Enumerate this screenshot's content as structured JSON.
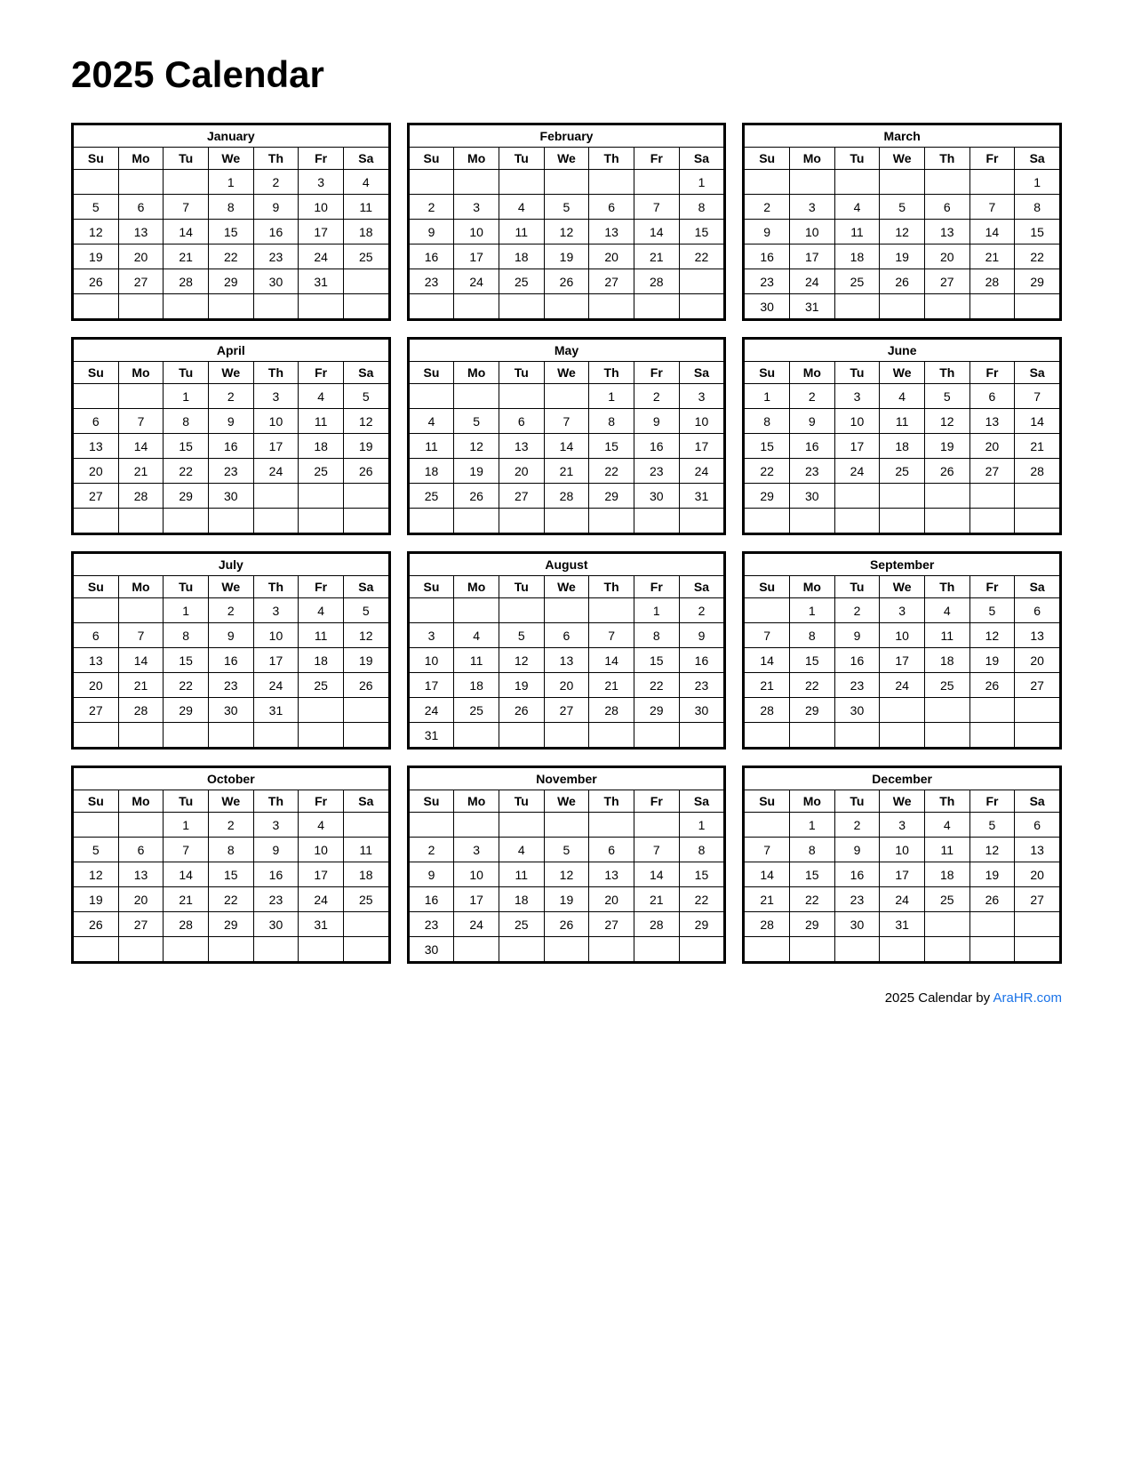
{
  "title": "2025 Calendar",
  "footer": {
    "text": "2025  Calendar by ",
    "link_text": "AraHR.com",
    "link_url": "https://AraHR.com"
  },
  "days_header": [
    "Su",
    "Mo",
    "Tu",
    "We",
    "Th",
    "Fr",
    "Sa"
  ],
  "months": [
    {
      "name": "January",
      "weeks": [
        [
          "",
          "",
          "",
          "1",
          "2",
          "3",
          "4"
        ],
        [
          "5",
          "6",
          "7",
          "8",
          "9",
          "10",
          "11"
        ],
        [
          "12",
          "13",
          "14",
          "15",
          "16",
          "17",
          "18"
        ],
        [
          "19",
          "20",
          "21",
          "22",
          "23",
          "24",
          "25"
        ],
        [
          "26",
          "27",
          "28",
          "29",
          "30",
          "31",
          ""
        ],
        [
          "",
          "",
          "",
          "",
          "",
          "",
          ""
        ]
      ]
    },
    {
      "name": "February",
      "weeks": [
        [
          "",
          "",
          "",
          "",
          "",
          "",
          "1"
        ],
        [
          "2",
          "3",
          "4",
          "5",
          "6",
          "7",
          "8"
        ],
        [
          "9",
          "10",
          "11",
          "12",
          "13",
          "14",
          "15"
        ],
        [
          "16",
          "17",
          "18",
          "19",
          "20",
          "21",
          "22"
        ],
        [
          "23",
          "24",
          "25",
          "26",
          "27",
          "28",
          ""
        ],
        [
          "",
          "",
          "",
          "",
          "",
          "",
          ""
        ]
      ]
    },
    {
      "name": "March",
      "weeks": [
        [
          "",
          "",
          "",
          "",
          "",
          "",
          "1"
        ],
        [
          "2",
          "3",
          "4",
          "5",
          "6",
          "7",
          "8"
        ],
        [
          "9",
          "10",
          "11",
          "12",
          "13",
          "14",
          "15"
        ],
        [
          "16",
          "17",
          "18",
          "19",
          "20",
          "21",
          "22"
        ],
        [
          "23",
          "24",
          "25",
          "26",
          "27",
          "28",
          "29"
        ],
        [
          "30",
          "31",
          "",
          "",
          "",
          "",
          ""
        ]
      ]
    },
    {
      "name": "April",
      "weeks": [
        [
          "",
          "",
          "1",
          "2",
          "3",
          "4",
          "5"
        ],
        [
          "6",
          "7",
          "8",
          "9",
          "10",
          "11",
          "12"
        ],
        [
          "13",
          "14",
          "15",
          "16",
          "17",
          "18",
          "19"
        ],
        [
          "20",
          "21",
          "22",
          "23",
          "24",
          "25",
          "26"
        ],
        [
          "27",
          "28",
          "29",
          "30",
          "",
          "",
          ""
        ],
        [
          "",
          "",
          "",
          "",
          "",
          "",
          ""
        ]
      ]
    },
    {
      "name": "May",
      "weeks": [
        [
          "",
          "",
          "",
          "",
          "1",
          "2",
          "3"
        ],
        [
          "4",
          "5",
          "6",
          "7",
          "8",
          "9",
          "10"
        ],
        [
          "11",
          "12",
          "13",
          "14",
          "15",
          "16",
          "17"
        ],
        [
          "18",
          "19",
          "20",
          "21",
          "22",
          "23",
          "24"
        ],
        [
          "25",
          "26",
          "27",
          "28",
          "29",
          "30",
          "31"
        ],
        [
          "",
          "",
          "",
          "",
          "",
          "",
          ""
        ]
      ]
    },
    {
      "name": "June",
      "weeks": [
        [
          "1",
          "2",
          "3",
          "4",
          "5",
          "6",
          "7"
        ],
        [
          "8",
          "9",
          "10",
          "11",
          "12",
          "13",
          "14"
        ],
        [
          "15",
          "16",
          "17",
          "18",
          "19",
          "20",
          "21"
        ],
        [
          "22",
          "23",
          "24",
          "25",
          "26",
          "27",
          "28"
        ],
        [
          "29",
          "30",
          "",
          "",
          "",
          "",
          ""
        ],
        [
          "",
          "",
          "",
          "",
          "",
          "",
          ""
        ]
      ]
    },
    {
      "name": "July",
      "weeks": [
        [
          "",
          "",
          "1",
          "2",
          "3",
          "4",
          "5"
        ],
        [
          "6",
          "7",
          "8",
          "9",
          "10",
          "11",
          "12"
        ],
        [
          "13",
          "14",
          "15",
          "16",
          "17",
          "18",
          "19"
        ],
        [
          "20",
          "21",
          "22",
          "23",
          "24",
          "25",
          "26"
        ],
        [
          "27",
          "28",
          "29",
          "30",
          "31",
          "",
          ""
        ],
        [
          "",
          "",
          "",
          "",
          "",
          "",
          ""
        ]
      ]
    },
    {
      "name": "August",
      "weeks": [
        [
          "",
          "",
          "",
          "",
          "",
          "1",
          "2"
        ],
        [
          "3",
          "4",
          "5",
          "6",
          "7",
          "8",
          "9"
        ],
        [
          "10",
          "11",
          "12",
          "13",
          "14",
          "15",
          "16"
        ],
        [
          "17",
          "18",
          "19",
          "20",
          "21",
          "22",
          "23"
        ],
        [
          "24",
          "25",
          "26",
          "27",
          "28",
          "29",
          "30"
        ],
        [
          "31",
          "",
          "",
          "",
          "",
          "",
          ""
        ]
      ]
    },
    {
      "name": "September",
      "weeks": [
        [
          "",
          "1",
          "2",
          "3",
          "4",
          "5",
          "6"
        ],
        [
          "7",
          "8",
          "9",
          "10",
          "11",
          "12",
          "13"
        ],
        [
          "14",
          "15",
          "16",
          "17",
          "18",
          "19",
          "20"
        ],
        [
          "21",
          "22",
          "23",
          "24",
          "25",
          "26",
          "27"
        ],
        [
          "28",
          "29",
          "30",
          "",
          "",
          "",
          ""
        ],
        [
          "",
          "",
          "",
          "",
          "",
          "",
          ""
        ]
      ]
    },
    {
      "name": "October",
      "weeks": [
        [
          "",
          "",
          "1",
          "2",
          "3",
          "4",
          ""
        ],
        [
          "5",
          "6",
          "7",
          "8",
          "9",
          "10",
          "11"
        ],
        [
          "12",
          "13",
          "14",
          "15",
          "16",
          "17",
          "18"
        ],
        [
          "19",
          "20",
          "21",
          "22",
          "23",
          "24",
          "25"
        ],
        [
          "26",
          "27",
          "28",
          "29",
          "30",
          "31",
          ""
        ],
        [
          "",
          "",
          "",
          "",
          "",
          "",
          ""
        ]
      ]
    },
    {
      "name": "November",
      "weeks": [
        [
          "",
          "",
          "",
          "",
          "",
          "",
          "1"
        ],
        [
          "2",
          "3",
          "4",
          "5",
          "6",
          "7",
          "8"
        ],
        [
          "9",
          "10",
          "11",
          "12",
          "13",
          "14",
          "15"
        ],
        [
          "16",
          "17",
          "18",
          "19",
          "20",
          "21",
          "22"
        ],
        [
          "23",
          "24",
          "25",
          "26",
          "27",
          "28",
          "29"
        ],
        [
          "30",
          "",
          "",
          "",
          "",
          "",
          ""
        ]
      ]
    },
    {
      "name": "December",
      "weeks": [
        [
          "",
          "1",
          "2",
          "3",
          "4",
          "5",
          "6"
        ],
        [
          "7",
          "8",
          "9",
          "10",
          "11",
          "12",
          "13"
        ],
        [
          "14",
          "15",
          "16",
          "17",
          "18",
          "19",
          "20"
        ],
        [
          "21",
          "22",
          "23",
          "24",
          "25",
          "26",
          "27"
        ],
        [
          "28",
          "29",
          "30",
          "31",
          "",
          "",
          ""
        ],
        [
          "",
          "",
          "",
          "",
          "",
          "",
          ""
        ]
      ]
    }
  ]
}
